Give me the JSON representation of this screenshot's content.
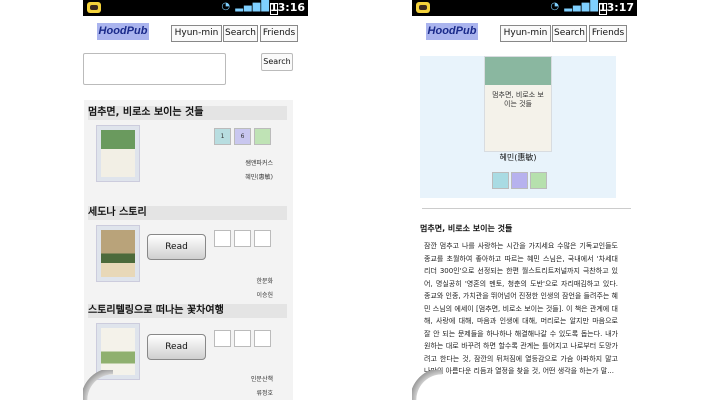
{
  "screens": [
    {
      "id": "left",
      "status": {
        "time": "13:16"
      },
      "nav": {
        "logo": "HoodPub",
        "user": "Hyun-min",
        "search": "Search",
        "friends": "Friends"
      },
      "search": {
        "placeholder": "",
        "button": "Search"
      },
      "items": [
        {
          "title": "멈추면, 비로소 보이는 것들",
          "squares": [
            "1",
            "6",
            ""
          ],
          "square_colors": [
            "#b8dde0",
            "#c9c7ef",
            "#bfe3b5"
          ],
          "read": "",
          "publisher": "쌤앤파커스",
          "author": "혜민(惠敏)"
        },
        {
          "title": "세도나 스토리",
          "squares": [
            "",
            "",
            ""
          ],
          "square_colors": [
            "#ffffff",
            "#ffffff",
            "#ffffff"
          ],
          "read": "Read",
          "publisher": "한문화",
          "author": "이승헌"
        },
        {
          "title": "스토리텔링으로 떠나는 꽃차여행",
          "squares": [
            "",
            "",
            ""
          ],
          "square_colors": [
            "#ffffff",
            "#ffffff",
            "#ffffff"
          ],
          "read": "Read",
          "publisher": "인문산책",
          "author": "류정호"
        }
      ]
    },
    {
      "id": "right",
      "status": {
        "time": "13:17"
      },
      "nav": {
        "logo": "HoodPub",
        "user": "Hyun-min",
        "search": "Search",
        "friends": "Friends"
      },
      "cover_text": "멈추면, 비로소 보이는 것들",
      "author": "혜민(惠敏)",
      "square_colors": [
        "#a9dbe3",
        "#b7b2ee",
        "#b6e0ad"
      ],
      "title": "멈추면, 비로소 보이는 것들",
      "description": "잠깐 멈추고 나를 사랑하는 시간을 가지세요 수많은 기독교인들도 종교를 초월하여 좋아하고 따르는 혜민 스님은, 국내에서 '차세대 리더 300인'으로 선정되는 한편 월스트리트저널까지 극찬하고 있어, 명실공히 '영혼의 멘토, 청춘의 도반'으로 자리매김하고 있다. 종교와 인종, 가치관을 뛰어넘어 진정한 인생의 잠언을 들려주는 혜민 스님의 에세이 [멈추면, 비로소 보이는 것들]. 이 책은 관계에 대해, 사랑에 대해, 마음과 인생에 대해, 머리로는 알지만 마음으로 잘 안 되는 문제들을 하나하나 해결해나갈 수 있도록 돕는다. 내가 원하는 대로 바꾸려 하면 할수록 관계는 틀어지고 나로부터 도망가려고 한다는 것, 잠깐의 뒤처짐에 열등감으로 가슴 아파하지 말고 나만의 아름다운 리듬과 열정을 찾을 것, 어떤 생각을 하는가 말..."
    }
  ]
}
